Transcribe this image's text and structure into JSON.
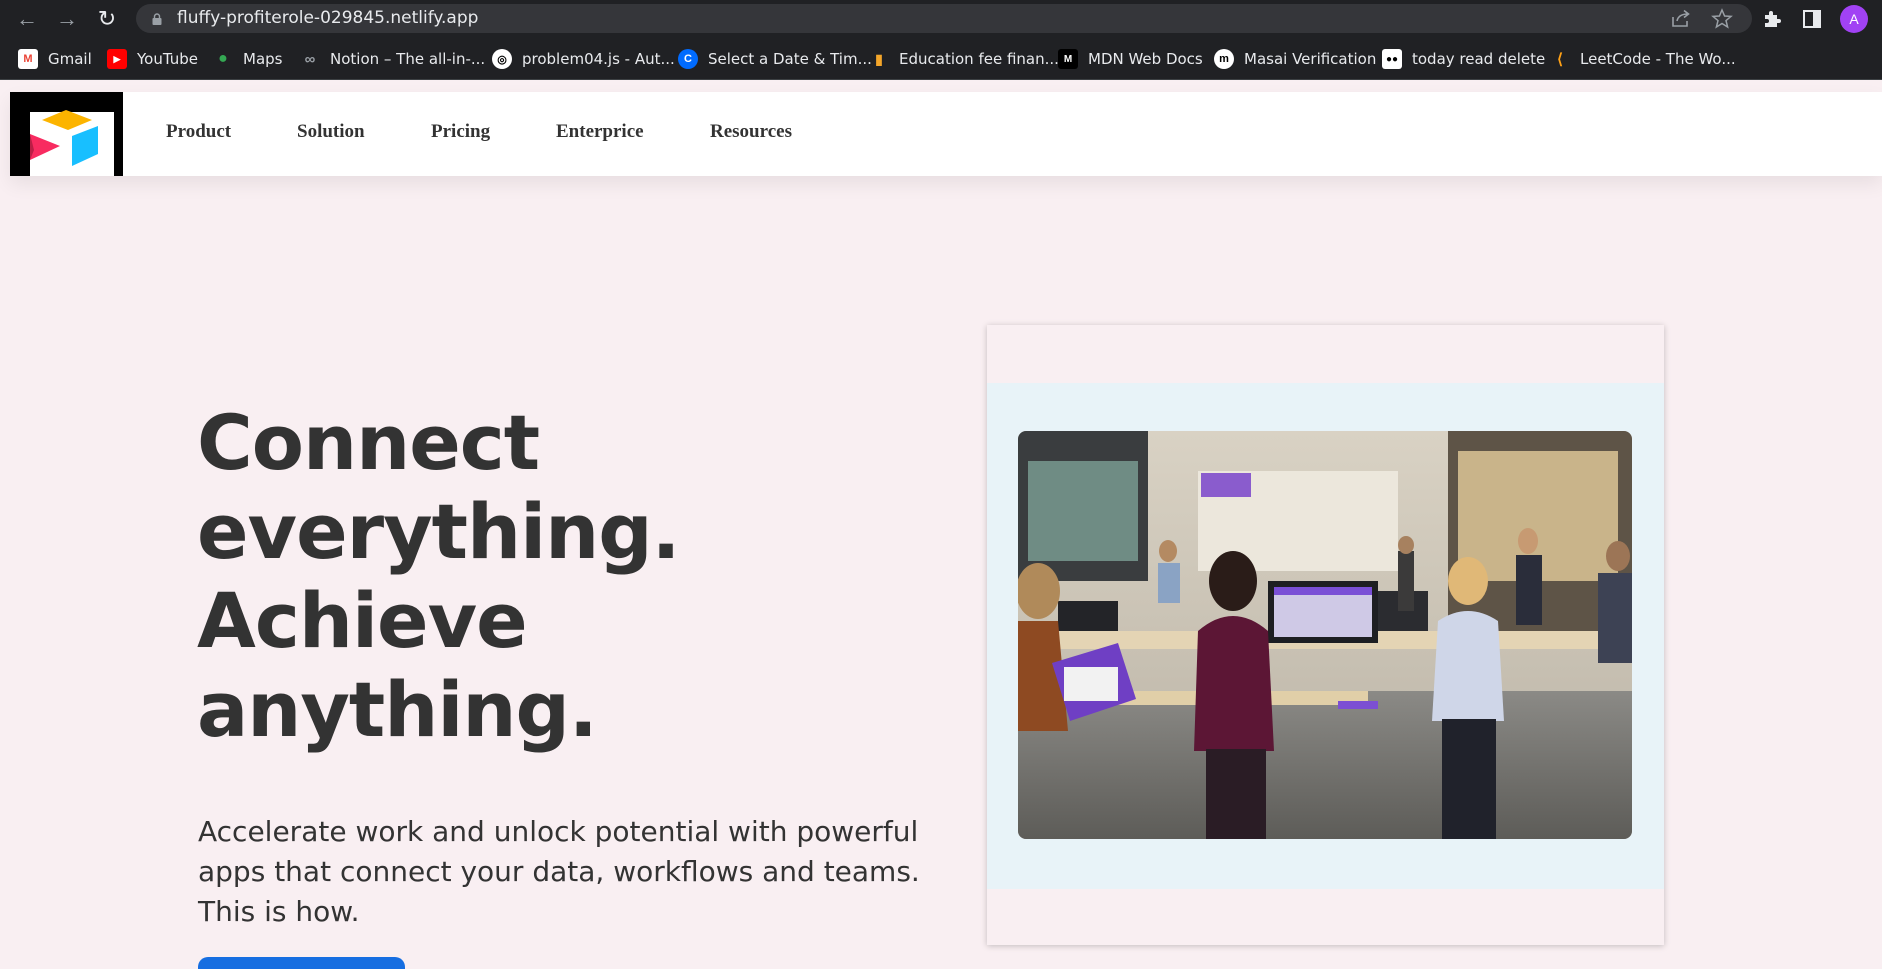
{
  "browser": {
    "url": "fluffy-profiterole-029845.netlify.app",
    "profile_initial": "A",
    "icons": {
      "back": "arrow-left-icon",
      "forward": "arrow-right-icon",
      "reload": "reload-icon",
      "lock": "lock-icon",
      "share": "share-icon",
      "bookmark": "star-icon",
      "extensions": "puzzle-icon",
      "side_panel": "side-panel-icon"
    },
    "bookmarks": [
      {
        "label": "Gmail",
        "icon": "gmail-icon",
        "color": "#ea4335"
      },
      {
        "label": "YouTube",
        "icon": "youtube-icon",
        "color": "#ff0000"
      },
      {
        "label": "Maps",
        "icon": "maps-icon",
        "color": "#34a853"
      },
      {
        "label": "Notion – The all-in-...",
        "icon": "link-icon",
        "color": "#9aa0a6"
      },
      {
        "label": "problem04.js - Aut...",
        "icon": "autograder-icon",
        "color": "#ffffff"
      },
      {
        "label": "Select a Date & Tim...",
        "icon": "calendly-icon",
        "color": "#006bff"
      },
      {
        "label": "Education fee finan...",
        "icon": "finance-icon",
        "color": "#f4a62a"
      },
      {
        "label": "MDN Web Docs",
        "icon": "mdn-icon",
        "color": "#000000"
      },
      {
        "label": "Masai Verification",
        "icon": "masai-icon",
        "color": "#ffffff"
      },
      {
        "label": "today read delete",
        "icon": "medium-icon",
        "color": "#ffffff"
      },
      {
        "label": "LeetCode - The Wo...",
        "icon": "leetcode-icon",
        "color": "#ffa116"
      }
    ]
  },
  "site": {
    "logo": "airtable-logo-icon",
    "nav": [
      "Product",
      "Solution",
      "Pricing",
      "Enterprice",
      "Resources"
    ],
    "hero": {
      "title_lines": [
        "Connect",
        "everything.",
        "Achieve",
        "anything."
      ],
      "subtitle": "Accelerate work and unlock potential with powerful apps that connect your data, workflows and teams. This is how."
    },
    "image": "office-team-photo",
    "colors": {
      "page_bg": "#f9eff2",
      "accent": "#166ee1",
      "card_inner": "#e8f3f8",
      "text": "#333333"
    }
  }
}
